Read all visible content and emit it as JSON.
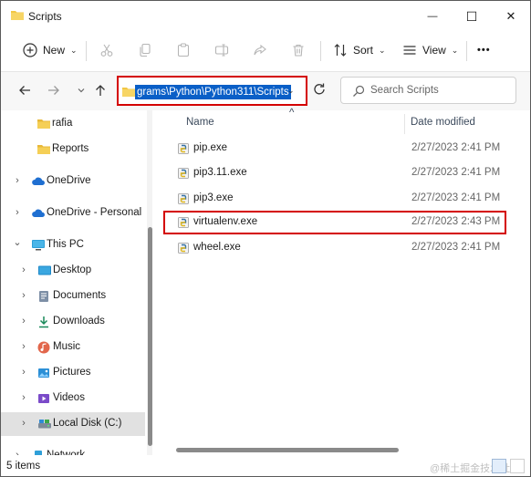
{
  "window": {
    "title": "Scripts",
    "minimize_glyph": "—",
    "maximize_glyph": "☐",
    "close_glyph": "✕"
  },
  "toolbar": {
    "new_label": "New",
    "sort_label": "Sort",
    "view_label": "View",
    "more_glyph": "•••",
    "dropdown_glyph": "⌄"
  },
  "address": {
    "path_text": "grams\\Python\\Python311\\Scripts",
    "chevron": "⌄"
  },
  "search": {
    "placeholder": "Search Scripts"
  },
  "sidebar": {
    "items": [
      {
        "label": "rafia",
        "icon": "folder-icon",
        "expanded": null
      },
      {
        "label": "Reports",
        "icon": "folder-icon",
        "expanded": null
      },
      {
        "label": "OneDrive",
        "icon": "cloud-icon",
        "expanded": false
      },
      {
        "label": "OneDrive - Personal",
        "icon": "cloud-icon",
        "expanded": false
      },
      {
        "label": "This PC",
        "icon": "computer-icon",
        "expanded": true
      },
      {
        "label": "Desktop",
        "icon": "desktop-icon",
        "expanded": false
      },
      {
        "label": "Documents",
        "icon": "documents-icon",
        "expanded": false
      },
      {
        "label": "Downloads",
        "icon": "downloads-icon",
        "expanded": false
      },
      {
        "label": "Music",
        "icon": "music-icon",
        "expanded": false
      },
      {
        "label": "Pictures",
        "icon": "pictures-icon",
        "expanded": false
      },
      {
        "label": "Videos",
        "icon": "videos-icon",
        "expanded": false
      },
      {
        "label": "Local Disk (C:)",
        "icon": "drive-icon",
        "expanded": false,
        "selected": true
      },
      {
        "label": "Network",
        "icon": "network-icon",
        "expanded": false
      }
    ]
  },
  "file_list": {
    "columns": [
      "Name",
      "Date modified"
    ],
    "sort_glyph": "^",
    "rows": [
      {
        "name": "pip.exe",
        "date": "2/27/2023 2:41 PM"
      },
      {
        "name": "pip3.11.exe",
        "date": "2/27/2023 2:41 PM"
      },
      {
        "name": "pip3.exe",
        "date": "2/27/2023 2:41 PM"
      },
      {
        "name": "virtualenv.exe",
        "date": "2/27/2023 2:43 PM",
        "highlighted": true
      },
      {
        "name": "wheel.exe",
        "date": "2/27/2023 2:41 PM"
      }
    ]
  },
  "status": {
    "item_count": "5 items",
    "watermark": "@稀土掘金技术社区"
  },
  "colors": {
    "accent_blue": "#0a5fc7",
    "highlight_red": "#d40000",
    "folder_yellow": "#f2c744",
    "selection_gray": "#e1e1e1"
  }
}
